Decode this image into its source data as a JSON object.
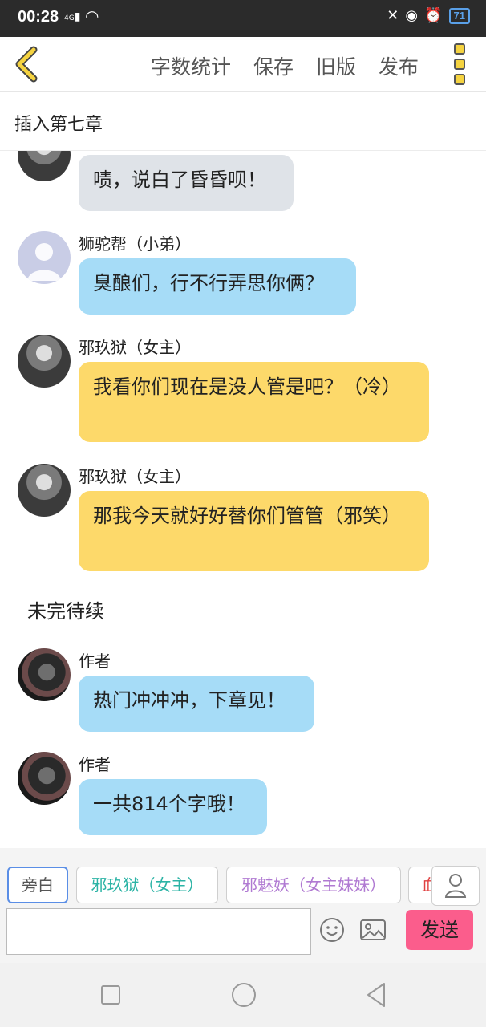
{
  "status_bar": {
    "time": "00:28",
    "network": "4G",
    "battery": "71"
  },
  "toolbar": {
    "menu": [
      "字数统计",
      "保存",
      "旧版",
      "发布"
    ]
  },
  "chapter": {
    "title": "插入第七章"
  },
  "messages": [
    {
      "name": "",
      "text": "啧，说白了昏昏呗！",
      "color": "gray"
    },
    {
      "name": "狮驼帮（小弟）",
      "text": "臭酿们，行不行弄思你俩？",
      "color": "blue"
    },
    {
      "name": "邪玖狱（女主）",
      "text": "我看你们现在是没人管是吧？（冷）",
      "color": "yellow"
    },
    {
      "name": "邪玖狱（女主）",
      "text": "那我今天就好好替你们管管（邪笑）",
      "color": "yellow"
    },
    {
      "narration": "未完待续"
    },
    {
      "name": "作者",
      "text": "热门冲冲冲，下章见！",
      "color": "blue"
    },
    {
      "name": "作者",
      "text": "一共814个字哦！",
      "color": "blue"
    }
  ],
  "role_chips": [
    {
      "label": "旁白",
      "color": "#555555"
    },
    {
      "label": "邪玖狱（女主）",
      "color": "#2bb3a5"
    },
    {
      "label": "邪魅妖（女主妹妹）",
      "color": "#b07ad2"
    },
    {
      "label": "血",
      "color": "#e04040"
    }
  ],
  "input": {
    "placeholder": "",
    "value": ""
  },
  "send_label": "发送",
  "colors": {
    "bubble_blue": "#a6dcf7",
    "bubble_yellow": "#fdd96a",
    "bubble_gray": "#dfe3e8",
    "send": "#fb5d8c",
    "back": "#f5d340"
  }
}
